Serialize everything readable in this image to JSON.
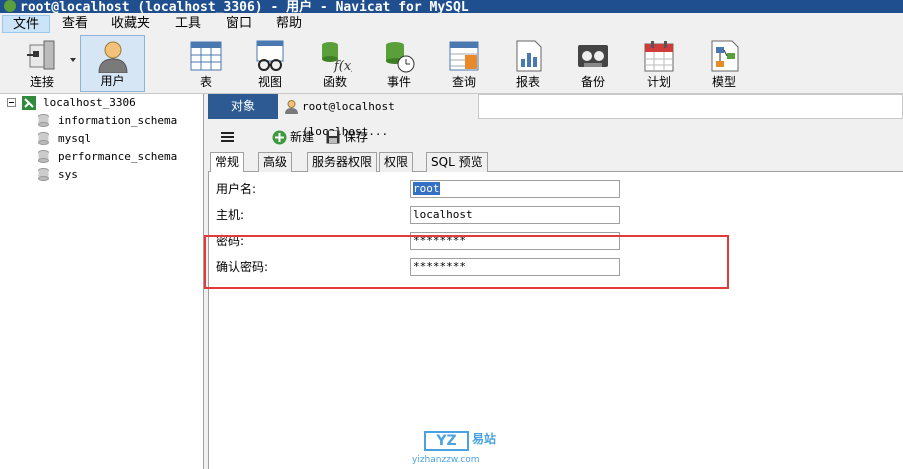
{
  "window": {
    "title": "root@localhost (localhost_3306) - 用户 - Navicat for MySQL"
  },
  "menu": [
    "文件",
    "查看",
    "收藏夹",
    "工具",
    "窗口",
    "帮助"
  ],
  "toolbar": {
    "connect": "连接",
    "user": "用户",
    "table": "表",
    "view": "视图",
    "function": "函数",
    "event": "事件",
    "query": "查询",
    "report": "报表",
    "backup": "备份",
    "schedule": "计划",
    "model": "模型"
  },
  "tree": {
    "connection": "localhost_3306",
    "databases": [
      "information_schema",
      "mysql",
      "performance_schema",
      "sys"
    ]
  },
  "tabs": {
    "objects": "对象",
    "editor": "root@localhost (localhost..."
  },
  "subtoolbar": {
    "new": "新建",
    "save": "保存"
  },
  "inner_tabs": [
    "常规",
    "高级",
    "服务器权限",
    "权限",
    "SQL 预览"
  ],
  "form": {
    "username_label": "用户名:",
    "username": "root",
    "host_label": "主机:",
    "host": "localhost",
    "password_label": "密码:",
    "password": "********",
    "confirm_label": "确认密码:",
    "confirm": "********"
  },
  "watermark": {
    "logo": "YZ",
    "name": "易站",
    "url": "yizhanzzw.com"
  },
  "colors": {
    "title_bar": "#1f4f8f",
    "accent": "#2d5a92",
    "highlight": "#e03a3a"
  }
}
